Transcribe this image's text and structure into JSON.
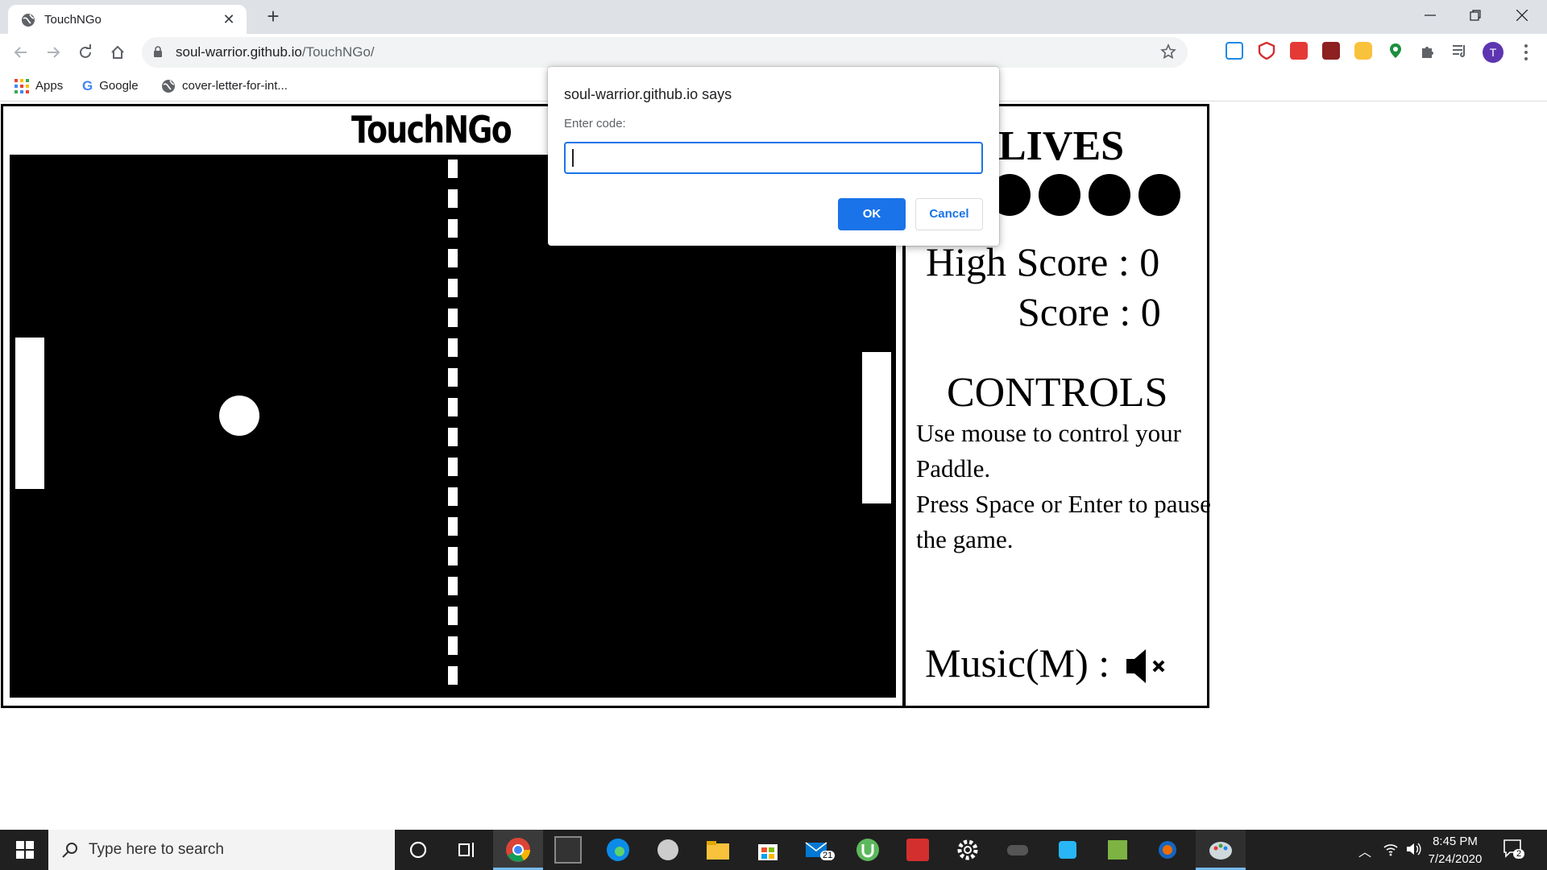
{
  "browser": {
    "tab_title": "TouchNGo",
    "url_domain": "soul-warrior.github.io",
    "url_path": "/TouchNGo/",
    "avatar_initial": "T",
    "bookmarks": [
      {
        "label": "Apps",
        "icon": "apps-grid-icon"
      },
      {
        "label": "Google",
        "icon": "google-icon"
      },
      {
        "label": "cover-letter-for-int...",
        "icon": "globe-icon"
      }
    ]
  },
  "game": {
    "title": "TouchNGo",
    "lives_label": "LIVES",
    "lives_count": 5,
    "high_score_label": "High Score : 0",
    "score_label": "Score : 0",
    "controls_title": "CONTROLS",
    "controls_line1": "Use mouse to control your Paddle.",
    "controls_line2": "Press Space or Enter to pause the game.",
    "music_label": "Music(M) :",
    "music_icon": "speaker-muted-icon"
  },
  "dialog": {
    "origin": "soul-warrior.github.io says",
    "prompt": "Enter code:",
    "input_value": "",
    "ok_label": "OK",
    "cancel_label": "Cancel"
  },
  "taskbar": {
    "search_placeholder": "Type here to search",
    "time": "8:45 PM",
    "date": "7/24/2020",
    "mail_badge": "21",
    "notification_badge": "2"
  },
  "colors": {
    "chrome_blue": "#1a73e8",
    "tabstrip_bg": "#dee1e6",
    "taskbar_bg": "#202020"
  }
}
